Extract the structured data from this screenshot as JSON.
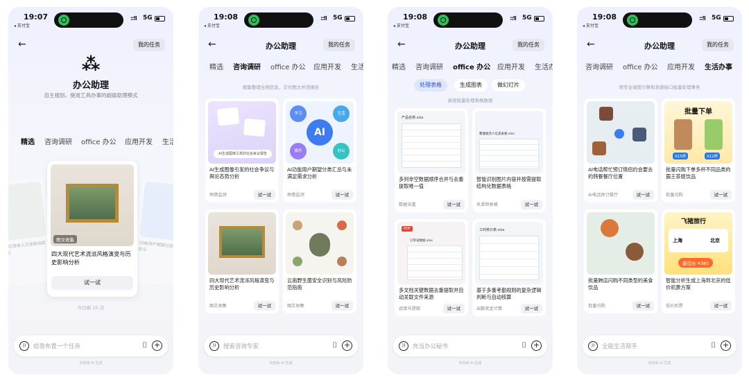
{
  "status": {
    "carrier": "◂ 支付宝",
    "network": "5G",
    "signal": "::!l",
    "times": [
      "19:07",
      "19:08",
      "19:08",
      "19:08"
    ]
  },
  "common": {
    "my_tasks": "我的任务",
    "try_label": "试一试",
    "footer": "内容由 AI 生成",
    "title": "办公助理"
  },
  "screen1": {
    "logo_glyph": "⁂",
    "title": "办公助理",
    "subtitle": "自主规划，使用工具办事的超级助理模式",
    "tabs": [
      "精选",
      "咨询调研",
      "office 办公",
      "应用开发",
      "生活"
    ],
    "featured": {
      "tag": "图文收集",
      "text": "四大现代艺术流派风格演变与历史影响分析",
      "button": "试一试"
    },
    "side_left": "2日游单人沉浸路线规划",
    "side_right": "I功能用户期望分类汇总与",
    "count": "今日剩 20 次",
    "placeholder": "给我布置一个任务"
  },
  "screen2": {
    "tabs": [
      "精选",
      "咨询调研",
      "office 办公",
      "应用开发",
      "生活"
    ],
    "subtitle": "搜集整理全网信息，交付图文并茂报告",
    "cards": [
      {
        "text": "AI生成图像引发的社会争议与舆论态势分析",
        "src": "舆情监测",
        "banner": "AI生成图像引发的社会争议报告"
      },
      {
        "text": "AI功能用户期望分类汇总与未满足需求分析",
        "src": "舆情监测",
        "badges": [
          "学习",
          "生活",
          "娱乐",
          "办公"
        ],
        "ai": "AI"
      },
      {
        "text": "四大现代艺术流派风格演变与历史影响分析",
        "src": "图文收集"
      },
      {
        "text": "云南野生菌安全识别与风险防范指南",
        "src": "图文收集"
      }
    ],
    "placeholder": "搜索咨询专家"
  },
  "screen3": {
    "tabs": [
      "精选",
      "咨询调研",
      "office 办公",
      "应用开发",
      "生活办"
    ],
    "chips": [
      "处理表格",
      "生成图表",
      "做幻灯片"
    ],
    "subtitle": "高效批量处理表格数据",
    "cards": [
      {
        "text": "多列非空数据顺序合并与去重提取唯一值",
        "src": "数据去重",
        "file": "产品名称.xlsx"
      },
      {
        "text": "智能识别图片内容并按需提取结构化数据表格",
        "src": "名单转表格",
        "file": "整理收货人信息表格.xlsx"
      },
      {
        "text": "多文档关键数据去重提取并自动关联文件来源",
        "src": "运单号提取",
        "file": "订单号数据.xlsx",
        "pdf": "PDF"
      },
      {
        "text": "基于多重考勤规则的复杂逻辑判断与自动核算",
        "src": "出勤奖金计算",
        "file": "工时统计表.xlsx"
      }
    ],
    "placeholder": "充当办公秘书"
  },
  "screen4": {
    "tabs": [
      "咨询调研",
      "office 办公",
      "应用开发",
      "生活办事"
    ],
    "subtitle": "用专业调度引擎和多路接口批量处理事务",
    "cards": [
      {
        "text": "AI电话帮忙预订情侣约会要去的韩餐餐厅位置",
        "src": "AI电话预订餐厅"
      },
      {
        "text": "批量闪购下单多杯不同品类的霸王茶姬饮品",
        "src": "批量闪购",
        "heading": "批量下单",
        "tags": [
          "X15杯",
          "X12杯"
        ]
      },
      {
        "text": "批量跨店闪购不同类型的美食饮品",
        "src": "批量闪购"
      },
      {
        "text": "智能分析生成上海到北京的低价机票方案",
        "src": "低价机票",
        "brand": "飞猪旅行",
        "from": "上海",
        "to": "北京",
        "price": "最低价 ¥380"
      }
    ],
    "placeholder": "全能生活帮手"
  }
}
